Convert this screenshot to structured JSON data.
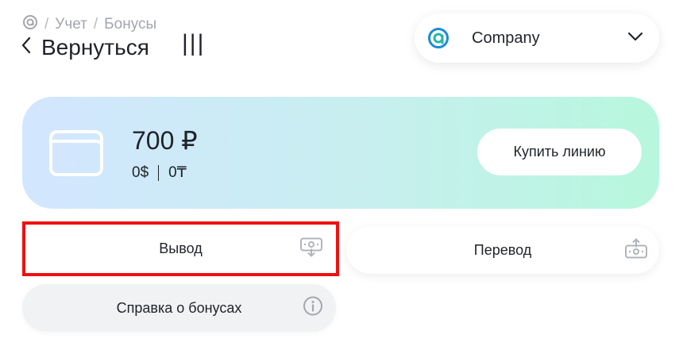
{
  "breadcrumb": {
    "items": [
      "Учет",
      "Бонусы"
    ],
    "separator": "/"
  },
  "header": {
    "back_label": "Вернуться",
    "tally_text": "|||"
  },
  "company": {
    "name": "Company",
    "accent": "#1a8bd6"
  },
  "balance": {
    "main": "700 ₽",
    "usd": "0$",
    "kzt": "0₸"
  },
  "actions": {
    "buy_label": "Купить линию",
    "withdraw_label": "Вывод",
    "transfer_label": "Перевод",
    "help_label": "Справка о бонусах"
  },
  "icons": {
    "brand": "brand-a-icon",
    "back": "chevron-left-icon",
    "dropdown": "chevron-down-icon",
    "wallet": "wallet-icon",
    "withdraw": "cash-withdraw-icon",
    "transfer": "cash-transfer-icon",
    "info": "info-icon"
  },
  "colors": {
    "highlight": "#ee1111",
    "card_gradient_start": "#d3e6ff",
    "card_gradient_end": "#b7f7dd"
  }
}
